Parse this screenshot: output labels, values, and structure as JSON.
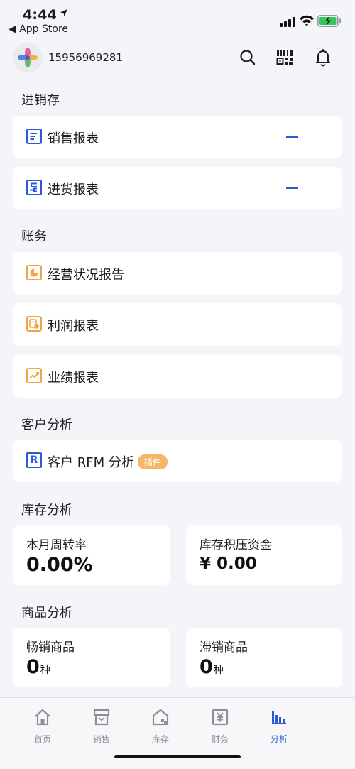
{
  "status_bar": {
    "time": "4:44",
    "back_label": "◀ App Store"
  },
  "header": {
    "phone": "15956969281",
    "icons": [
      "search-icon",
      "qr-scan-icon",
      "bell-icon"
    ]
  },
  "sections": {
    "inventory": {
      "title": "进销存",
      "items": [
        {
          "label": "销售报表",
          "icon": "sales-report-icon"
        },
        {
          "label": "进货报表",
          "icon": "purchase-report-icon"
        }
      ]
    },
    "finance": {
      "title": "账务",
      "items": [
        {
          "label": "经营状况报告",
          "icon": "pie-chart-icon"
        },
        {
          "label": "利润报表",
          "icon": "profit-icon"
        },
        {
          "label": "业绩报表",
          "icon": "trend-icon"
        }
      ]
    },
    "customer": {
      "title": "客户分析",
      "rfm_label": "客户 RFM 分析",
      "rfm_badge": "插件",
      "rfm_icon_letter": "R"
    },
    "stock": {
      "title": "库存分析",
      "turnover": {
        "label": "本月周转率",
        "value": "0.00%"
      },
      "overstock": {
        "label": "库存积压资金",
        "value": "¥ 0.00"
      }
    },
    "product": {
      "title": "商品分析",
      "best": {
        "label": "畅销商品",
        "value": "0",
        "unit": "种"
      },
      "slow": {
        "label": "滞销商品",
        "value": "0",
        "unit": "种"
      }
    }
  },
  "tabbar": {
    "active": "分析",
    "tabs": [
      {
        "label": "首页",
        "icon": "home-icon"
      },
      {
        "label": "销售",
        "icon": "store-icon"
      },
      {
        "label": "库存",
        "icon": "warehouse-icon"
      },
      {
        "label": "财务",
        "icon": "finance-icon"
      },
      {
        "label": "分析",
        "icon": "analysis-icon"
      }
    ]
  },
  "colors": {
    "accent": "#2a5bd7",
    "orange": "#f0a54a",
    "background": "#f4f5f8"
  }
}
